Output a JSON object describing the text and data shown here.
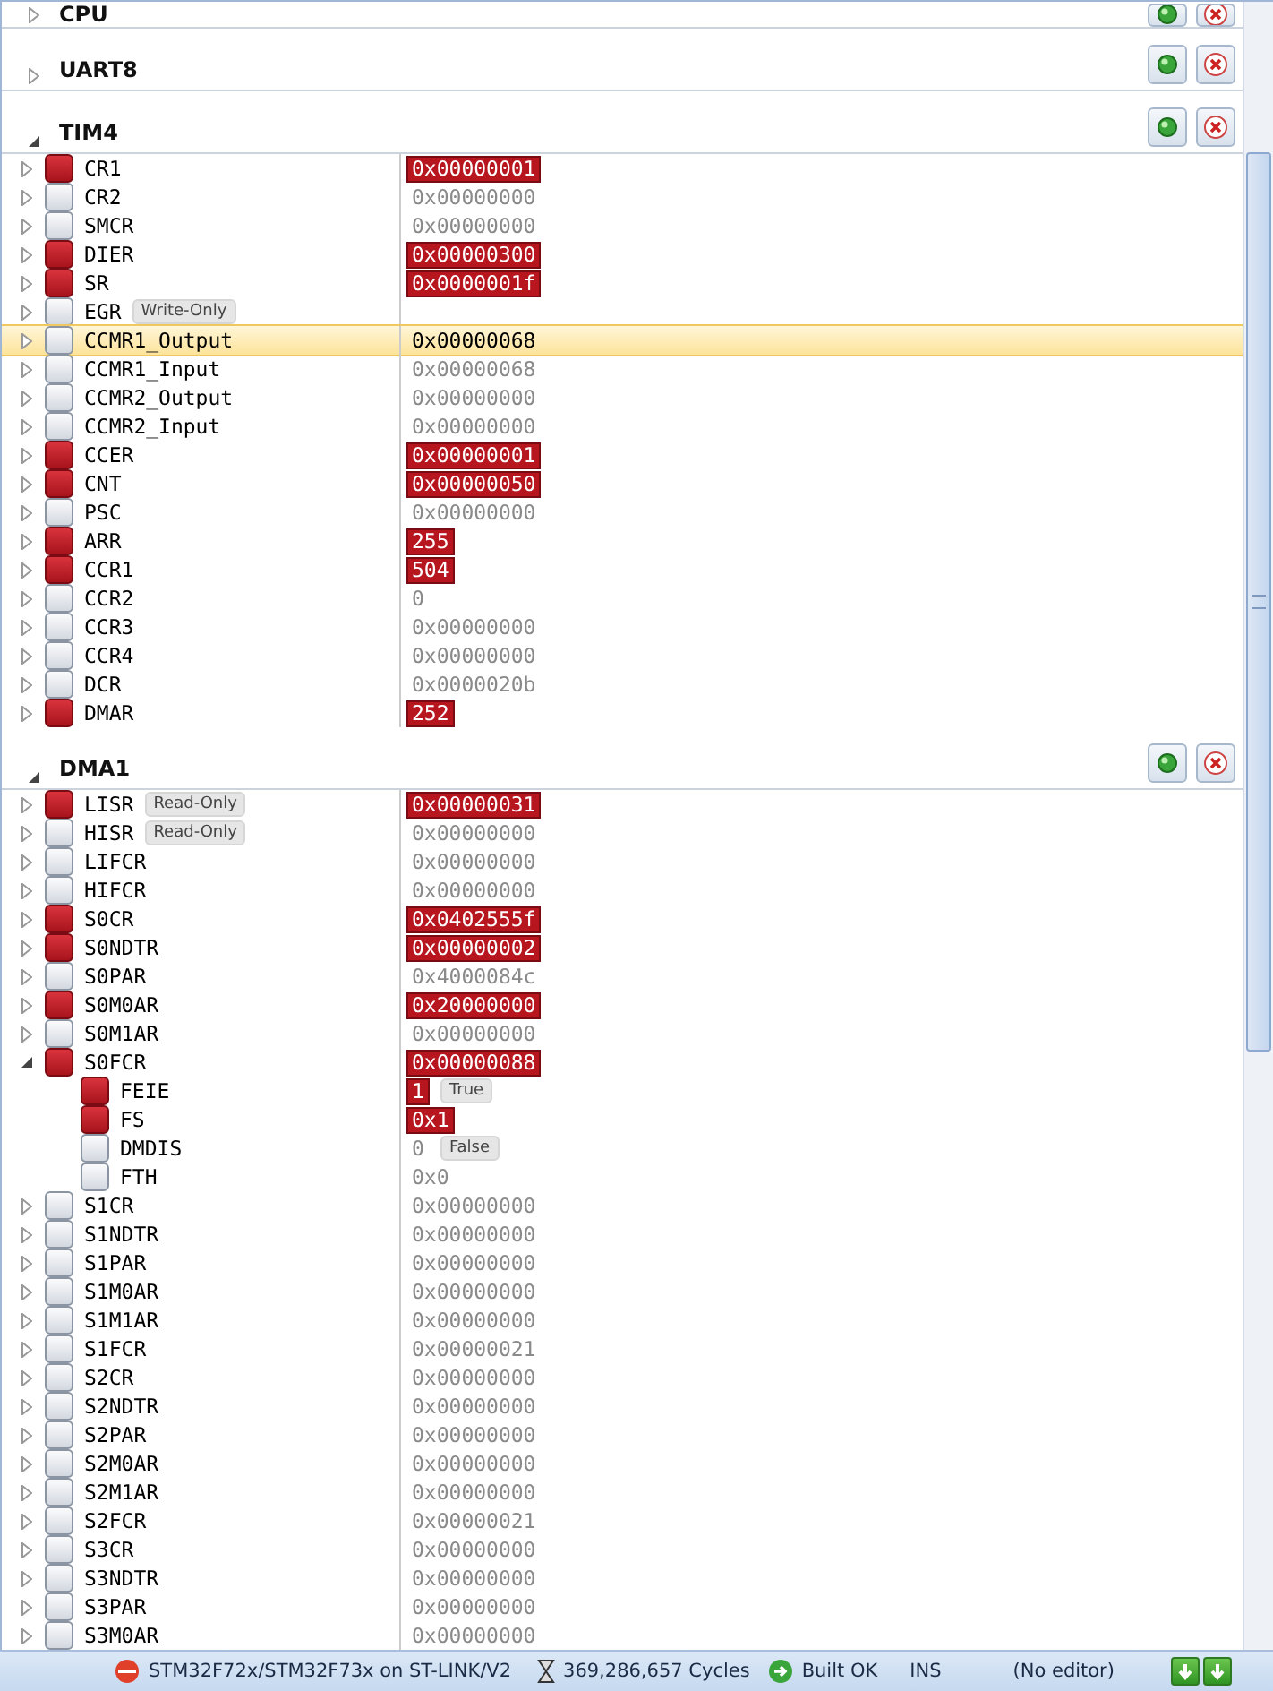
{
  "sections": [
    {
      "name": "CPU",
      "expanded": false
    },
    {
      "name": "UART8",
      "expanded": false
    },
    {
      "name": "TIM4",
      "expanded": true,
      "registers": [
        {
          "name": "CR1",
          "value": "0x00000001",
          "changed": true,
          "selected": false,
          "expanded": false
        },
        {
          "name": "CR2",
          "value": "0x00000000",
          "changed": false,
          "selected": false,
          "expanded": false
        },
        {
          "name": "SMCR",
          "value": "0x00000000",
          "changed": false,
          "selected": false,
          "expanded": false
        },
        {
          "name": "DIER",
          "value": "0x00000300",
          "changed": true,
          "selected": false,
          "expanded": false
        },
        {
          "name": "SR",
          "value": "0x0000001f",
          "changed": true,
          "selected": false,
          "expanded": false
        },
        {
          "name": "EGR",
          "badge": "Write-Only",
          "changed": false,
          "selected": false,
          "expanded": false
        },
        {
          "name": "CCMR1_Output",
          "value": "0x00000068",
          "changed": false,
          "selected": true,
          "expanded": false
        },
        {
          "name": "CCMR1_Input",
          "value": "0x00000068",
          "changed": false,
          "selected": false,
          "expanded": false
        },
        {
          "name": "CCMR2_Output",
          "value": "0x00000000",
          "changed": false,
          "selected": false,
          "expanded": false
        },
        {
          "name": "CCMR2_Input",
          "value": "0x00000000",
          "changed": false,
          "selected": false,
          "expanded": false
        },
        {
          "name": "CCER",
          "value": "0x00000001",
          "changed": true,
          "selected": false,
          "expanded": false
        },
        {
          "name": "CNT",
          "value": "0x00000050",
          "changed": true,
          "selected": false,
          "expanded": false
        },
        {
          "name": "PSC",
          "value": "0x00000000",
          "changed": false,
          "selected": false,
          "expanded": false
        },
        {
          "name": "ARR",
          "value": "255",
          "changed": true,
          "selected": false,
          "expanded": false
        },
        {
          "name": "CCR1",
          "value": "504",
          "changed": true,
          "selected": false,
          "expanded": false
        },
        {
          "name": "CCR2",
          "value": "0",
          "changed": false,
          "selected": false,
          "expanded": false
        },
        {
          "name": "CCR3",
          "value": "0x00000000",
          "changed": false,
          "selected": false,
          "expanded": false
        },
        {
          "name": "CCR4",
          "value": "0x00000000",
          "changed": false,
          "selected": false,
          "expanded": false
        },
        {
          "name": "DCR",
          "value": "0x0000020b",
          "changed": false,
          "selected": false,
          "expanded": false
        },
        {
          "name": "DMAR",
          "value": "252",
          "changed": true,
          "selected": false,
          "expanded": false
        }
      ]
    },
    {
      "name": "DMA1",
      "expanded": true,
      "registers": [
        {
          "name": "LISR",
          "badge": "Read-Only",
          "value": "0x00000031",
          "changed": true,
          "selected": false,
          "expanded": false
        },
        {
          "name": "HISR",
          "badge": "Read-Only",
          "value": "0x00000000",
          "changed": false,
          "selected": false,
          "expanded": false
        },
        {
          "name": "LIFCR",
          "value": "0x00000000",
          "changed": false,
          "selected": false,
          "expanded": false
        },
        {
          "name": "HIFCR",
          "value": "0x00000000",
          "changed": false,
          "selected": false,
          "expanded": false
        },
        {
          "name": "S0CR",
          "value": "0x0402555f",
          "changed": true,
          "selected": false,
          "expanded": false
        },
        {
          "name": "S0NDTR",
          "value": "0x00000002",
          "changed": true,
          "selected": false,
          "expanded": false
        },
        {
          "name": "S0PAR",
          "value": "0x4000084c",
          "changed": false,
          "selected": false,
          "expanded": false
        },
        {
          "name": "S0M0AR",
          "value": "0x20000000",
          "changed": true,
          "selected": false,
          "expanded": false
        },
        {
          "name": "S0M1AR",
          "value": "0x00000000",
          "changed": false,
          "selected": false,
          "expanded": false
        },
        {
          "name": "S0FCR",
          "value": "0x00000088",
          "changed": true,
          "selected": false,
          "expanded": true,
          "children": [
            {
              "name": "FEIE",
              "value": "1",
              "value_badge": "True",
              "changed": true,
              "selected": false
            },
            {
              "name": "FS",
              "value": "0x1",
              "changed": true,
              "selected": false
            },
            {
              "name": "DMDIS",
              "value": "0",
              "value_badge": "False",
              "changed": false,
              "selected": false
            },
            {
              "name": "FTH",
              "value": "0x0",
              "changed": false,
              "selected": false
            }
          ]
        },
        {
          "name": "S1CR",
          "value": "0x00000000",
          "changed": false,
          "selected": false,
          "expanded": false
        },
        {
          "name": "S1NDTR",
          "value": "0x00000000",
          "changed": false,
          "selected": false,
          "expanded": false
        },
        {
          "name": "S1PAR",
          "value": "0x00000000",
          "changed": false,
          "selected": false,
          "expanded": false
        },
        {
          "name": "S1M0AR",
          "value": "0x00000000",
          "changed": false,
          "selected": false,
          "expanded": false
        },
        {
          "name": "S1M1AR",
          "value": "0x00000000",
          "changed": false,
          "selected": false,
          "expanded": false
        },
        {
          "name": "S1FCR",
          "value": "0x00000021",
          "changed": false,
          "selected": false,
          "expanded": false
        },
        {
          "name": "S2CR",
          "value": "0x00000000",
          "changed": false,
          "selected": false,
          "expanded": false
        },
        {
          "name": "S2NDTR",
          "value": "0x00000000",
          "changed": false,
          "selected": false,
          "expanded": false
        },
        {
          "name": "S2PAR",
          "value": "0x00000000",
          "changed": false,
          "selected": false,
          "expanded": false
        },
        {
          "name": "S2M0AR",
          "value": "0x00000000",
          "changed": false,
          "selected": false,
          "expanded": false
        },
        {
          "name": "S2M1AR",
          "value": "0x00000000",
          "changed": false,
          "selected": false,
          "expanded": false
        },
        {
          "name": "S2FCR",
          "value": "0x00000021",
          "changed": false,
          "selected": false,
          "expanded": false
        },
        {
          "name": "S3CR",
          "value": "0x00000000",
          "changed": false,
          "selected": false,
          "expanded": false
        },
        {
          "name": "S3NDTR",
          "value": "0x00000000",
          "changed": false,
          "selected": false,
          "expanded": false
        },
        {
          "name": "S3PAR",
          "value": "0x00000000",
          "changed": false,
          "selected": false,
          "expanded": false
        },
        {
          "name": "S3M0AR",
          "value": "0x00000000",
          "changed": false,
          "selected": false,
          "expanded": false
        }
      ]
    }
  ],
  "status_bar": {
    "target": "STM32F72x/STM32F73x on ST-LINK/V2",
    "cycles": "369,286,657 Cycles",
    "build": "Built OK",
    "mode": "INS",
    "editor": "(No editor)"
  }
}
